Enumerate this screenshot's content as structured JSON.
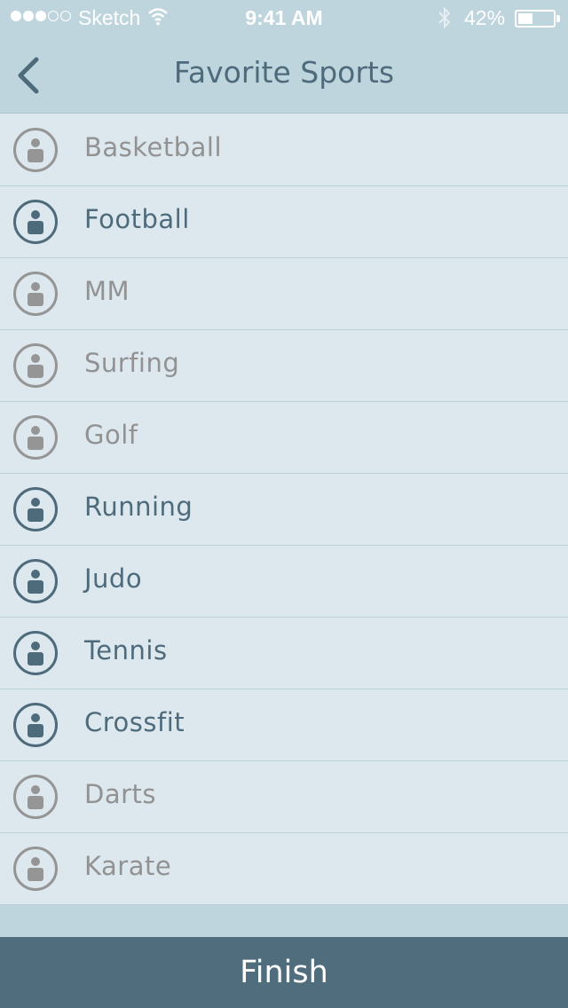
{
  "status_bar": {
    "carrier": "Sketch",
    "time": "9:41 AM",
    "battery_percent": "42%",
    "battery_level": 0.42,
    "signal_bars_filled": 3,
    "signal_bars_total": 5
  },
  "header": {
    "title": "Favorite Sports",
    "back_icon": "chevron-left-icon"
  },
  "sports": [
    {
      "label": "Basketball",
      "selected": false
    },
    {
      "label": "Football",
      "selected": true
    },
    {
      "label": "MM",
      "selected": false
    },
    {
      "label": "Surfing",
      "selected": false
    },
    {
      "label": "Golf",
      "selected": false
    },
    {
      "label": "Running",
      "selected": true
    },
    {
      "label": "Judo",
      "selected": true
    },
    {
      "label": "Tennis",
      "selected": true
    },
    {
      "label": "Crossfit",
      "selected": true
    },
    {
      "label": "Darts",
      "selected": false
    },
    {
      "label": "Karate",
      "selected": false
    }
  ],
  "footer": {
    "finish_label": "Finish"
  },
  "colors": {
    "header_bg": "#bfd5de",
    "list_bg": "#dce8ee",
    "selected": "#4e6b7c",
    "unselected": "#959595",
    "finish_bg": "#506d7d"
  }
}
